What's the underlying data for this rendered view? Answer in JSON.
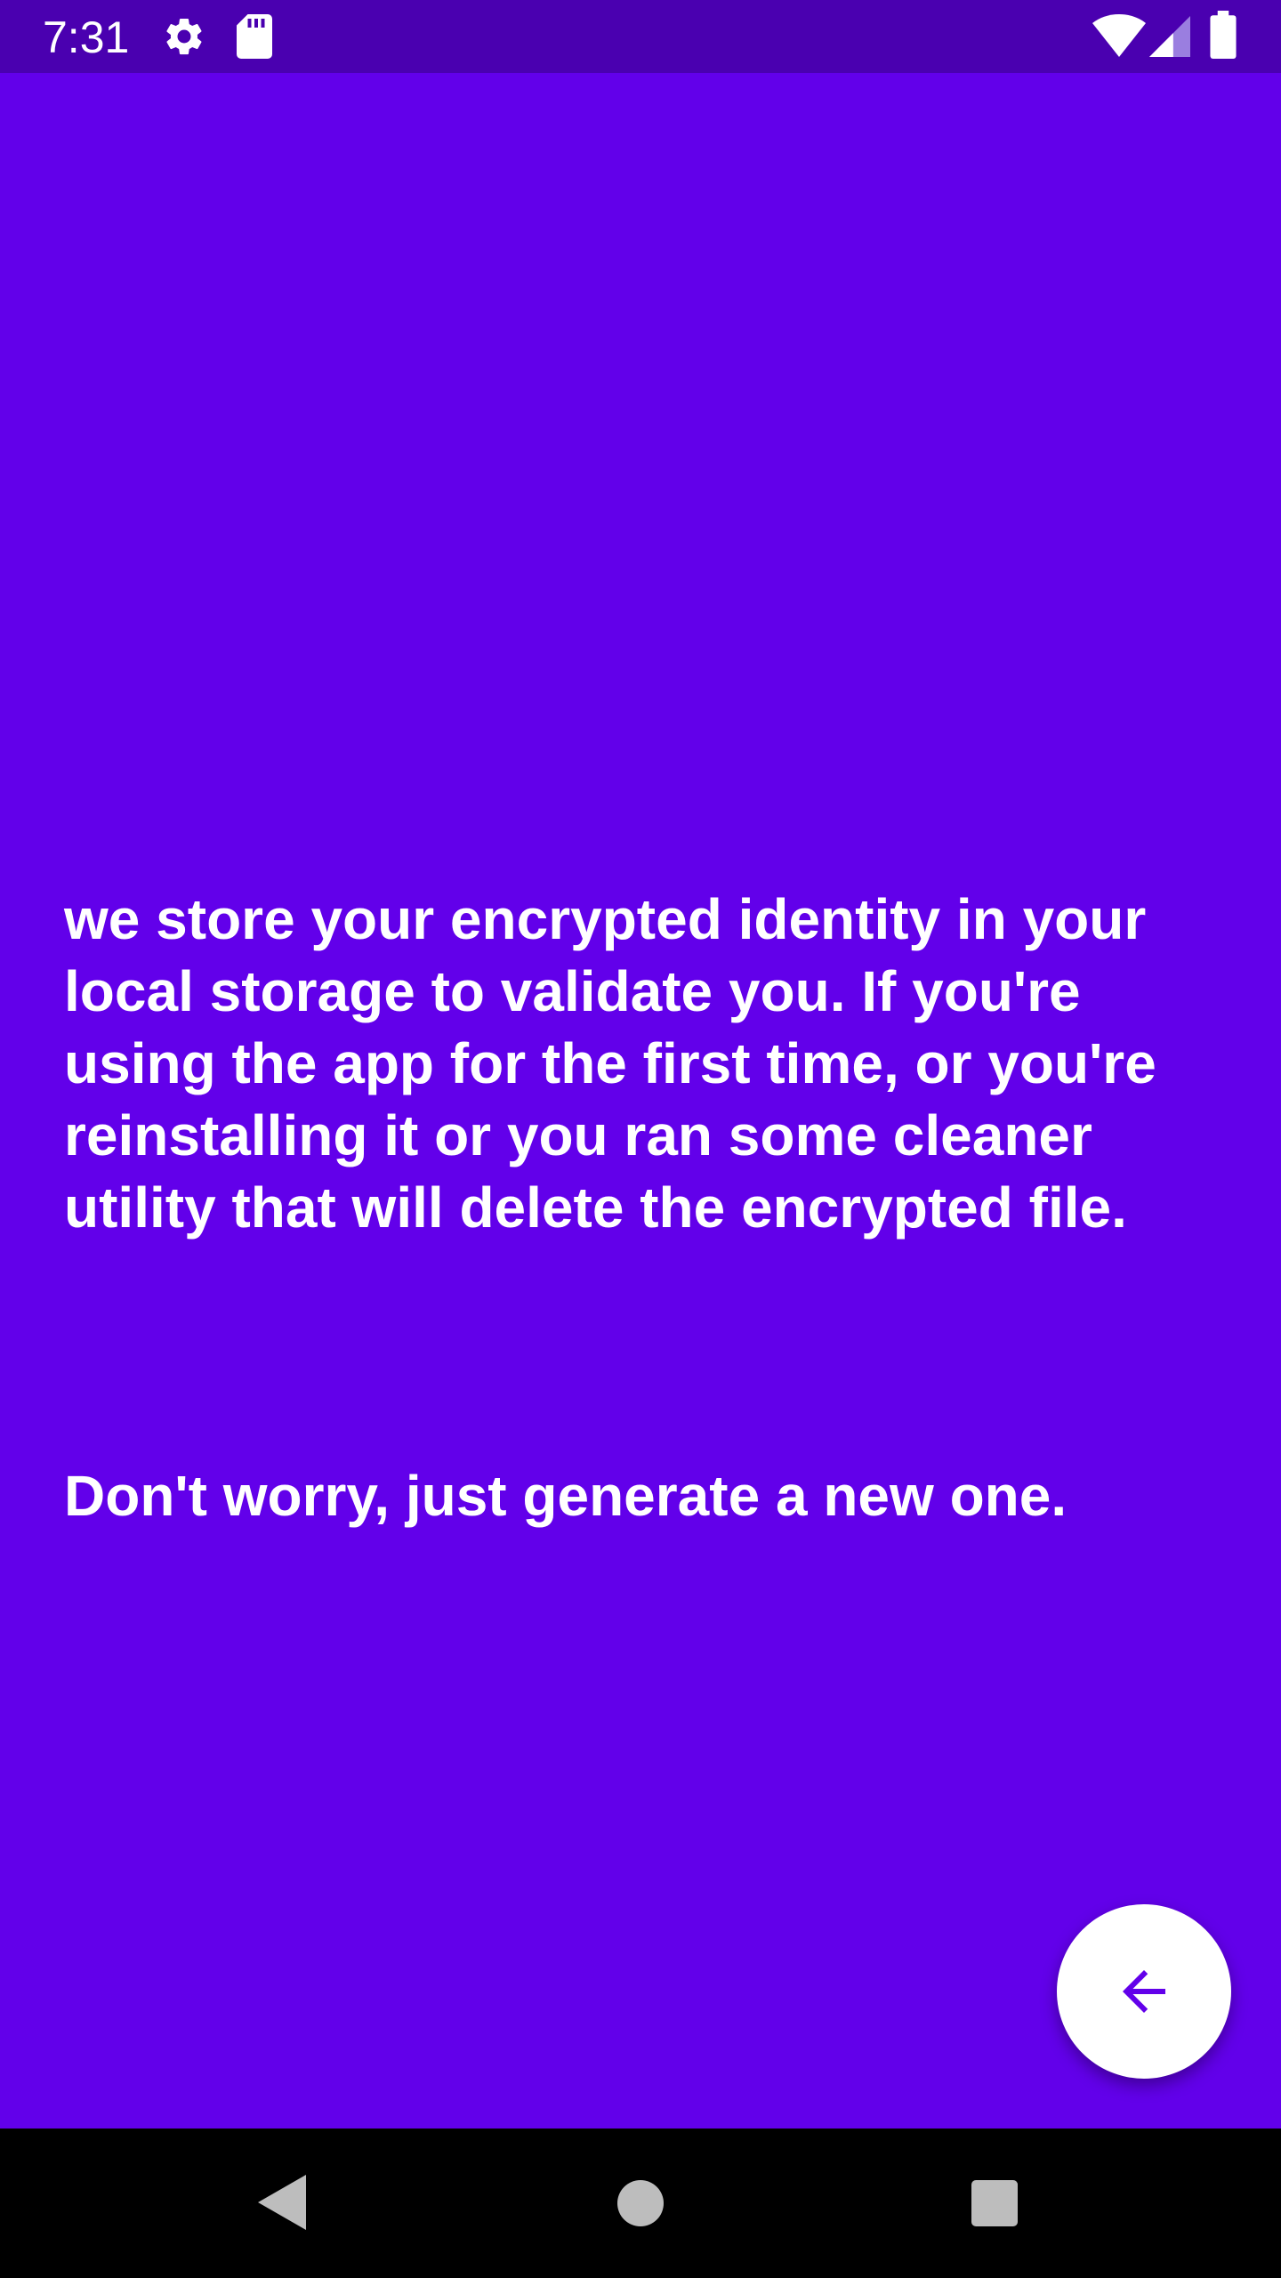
{
  "status_bar": {
    "time": "7:31",
    "icons": [
      "gear-icon",
      "sd-card-icon",
      "wifi-icon",
      "cell-signal-icon",
      "battery-icon"
    ],
    "background": "#4a00b0"
  },
  "main": {
    "background": "#6200ea",
    "paragraph_1": "we store your encrypted identity in your local storage to validate you. If you're using the app for the first time, or you're reinstalling it or you ran some cleaner utility that will delete the encrypted file.",
    "paragraph_2": "Don't worry, just generate a new one."
  },
  "fab": {
    "icon": "arrow-back-icon",
    "background": "#ffffff",
    "icon_color": "#6200ea"
  },
  "nav_bar": {
    "buttons": [
      "back-triangle-icon",
      "home-circle-icon",
      "recents-square-icon"
    ],
    "background": "#000000"
  }
}
